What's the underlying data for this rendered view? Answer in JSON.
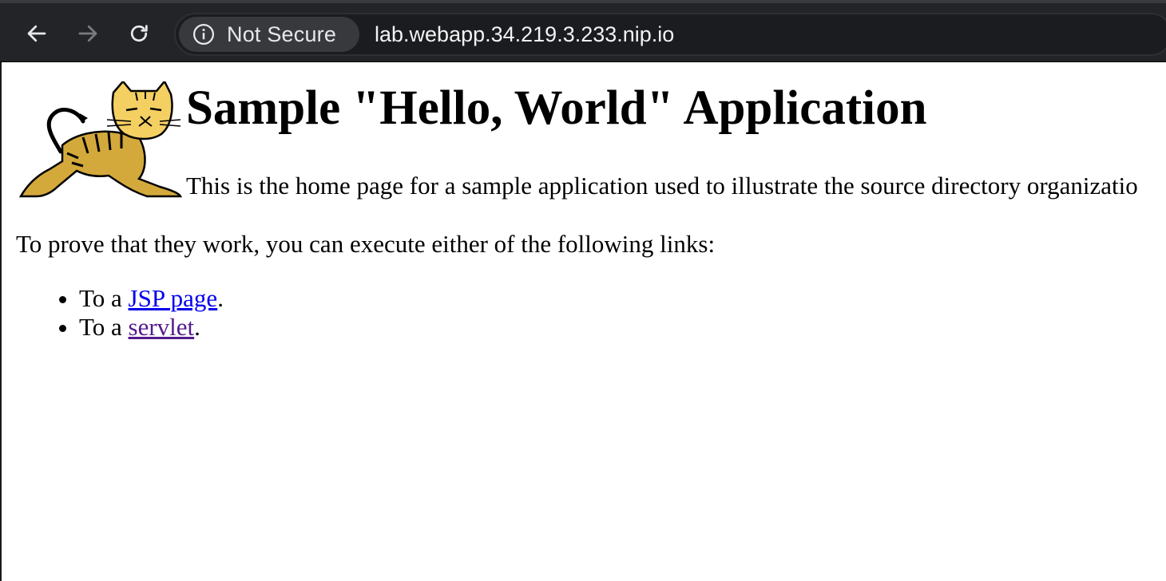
{
  "browser": {
    "security_label": "Not Secure",
    "url": "lab.webapp.34.219.3.233.nip.io",
    "icons": {
      "back": "back-arrow-icon",
      "forward": "forward-arrow-icon",
      "reload": "reload-icon",
      "info": "info-icon"
    }
  },
  "page": {
    "title": "Sample \"Hello, World\" Application",
    "intro": "This is the home page for a sample application used to illustrate the source directory organizatio",
    "prove_text": "To prove that they work, you can execute either of the following links:",
    "links": [
      {
        "prefix": "To a ",
        "link_text": "JSP page",
        "suffix": "."
      },
      {
        "prefix": "To a ",
        "link_text": "servlet",
        "suffix": "."
      }
    ],
    "colors": {
      "link": "#0000ee",
      "visited_link": "#551a8b",
      "logo_yellow": "#d4a93c"
    }
  }
}
